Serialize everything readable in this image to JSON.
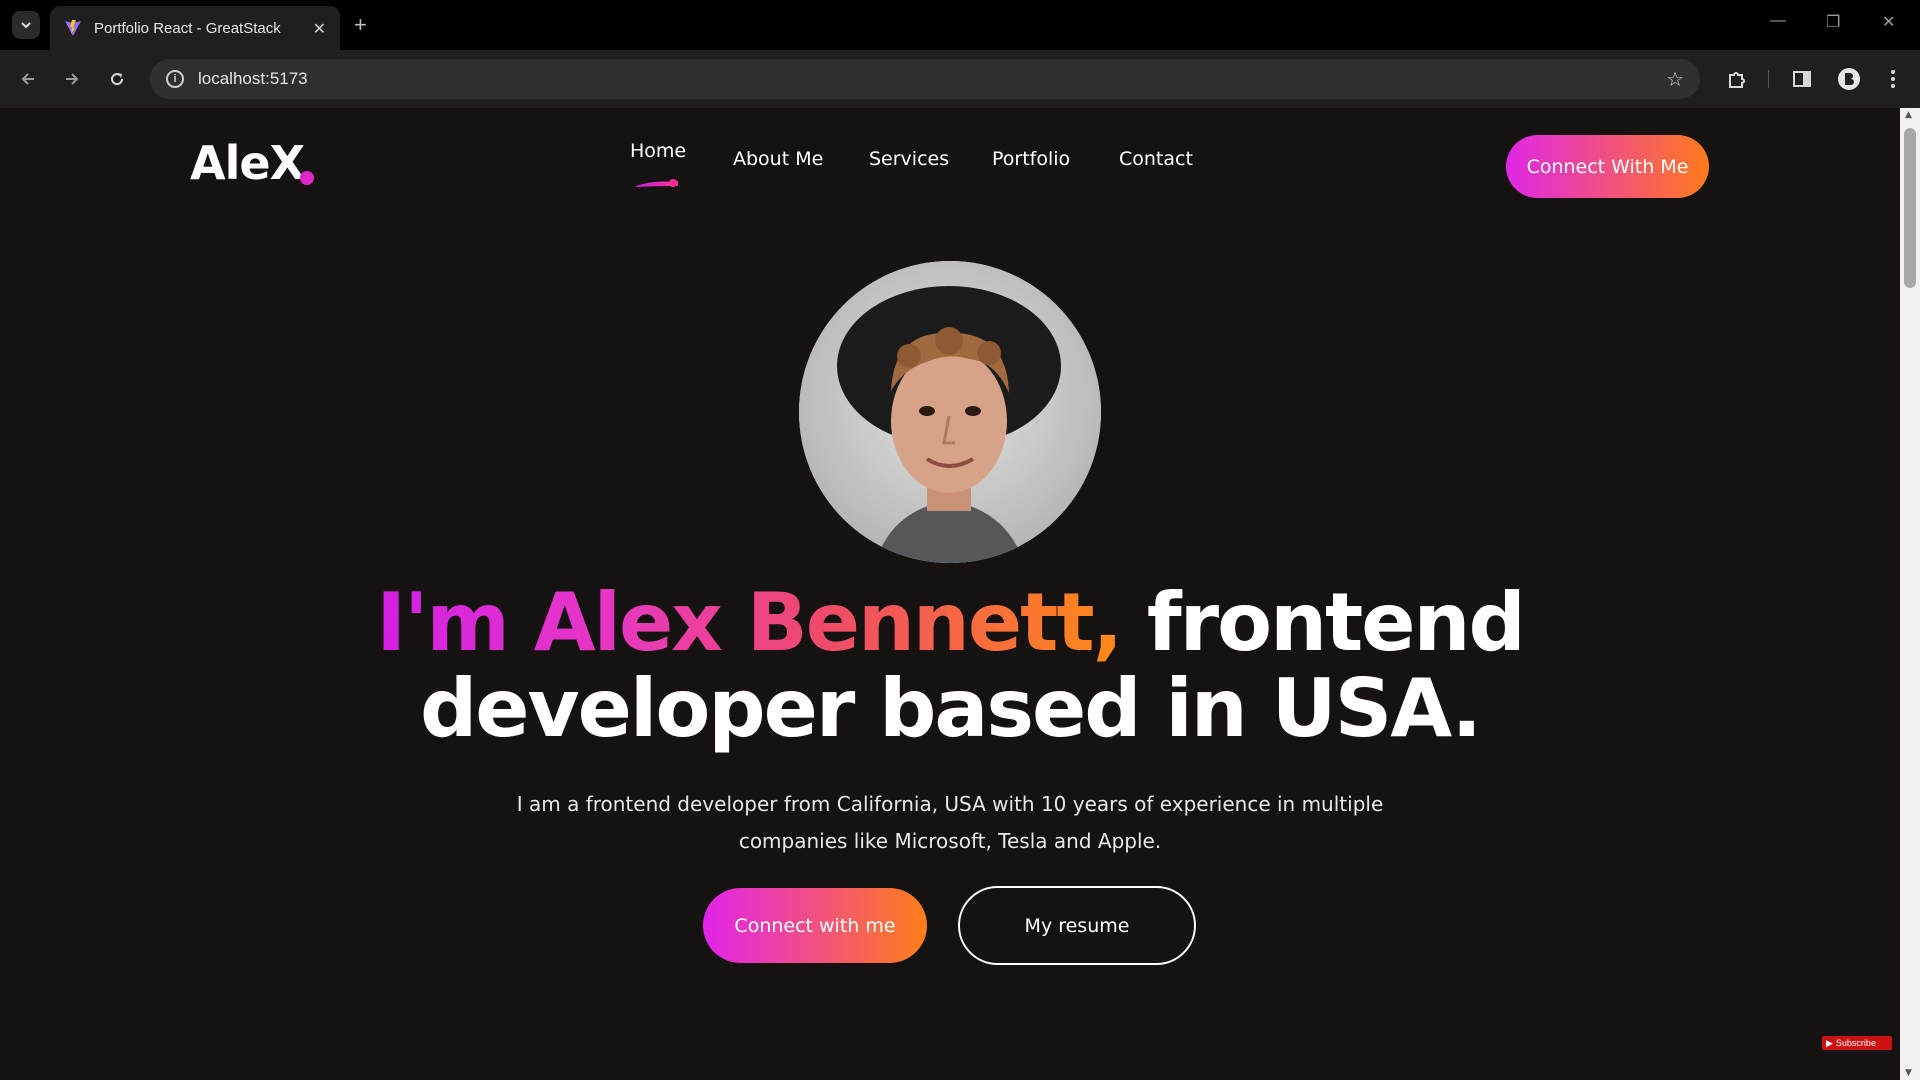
{
  "browser": {
    "tab_title": "Portfolio React - GreatStack",
    "tab_close": "✕",
    "new_tab": "+",
    "url": "localhost:5173",
    "window_controls": [
      "—",
      "❐",
      "✕"
    ]
  },
  "nav": {
    "logo": "AleX",
    "items": [
      "Home",
      "About Me",
      "Services",
      "Portfolio",
      "Contact"
    ],
    "active": "Home",
    "cta": "Connect With Me"
  },
  "hero": {
    "title_highlight": "I'm Alex Bennett,",
    "title_rest_line1": " frontend",
    "title_line2": "developer based in USA.",
    "description": "I am a frontend developer from California, USA with 10 years of experience in multiple companies like Microsoft, Tesla and Apple.",
    "button_primary": "Connect with me",
    "button_secondary": "My resume"
  },
  "overlay": {
    "subscribe_badge": "Subscribe"
  },
  "colors": {
    "page_bg": "#161212",
    "gradient_start": "#df27e6",
    "gradient_end": "#ff7b1c"
  }
}
